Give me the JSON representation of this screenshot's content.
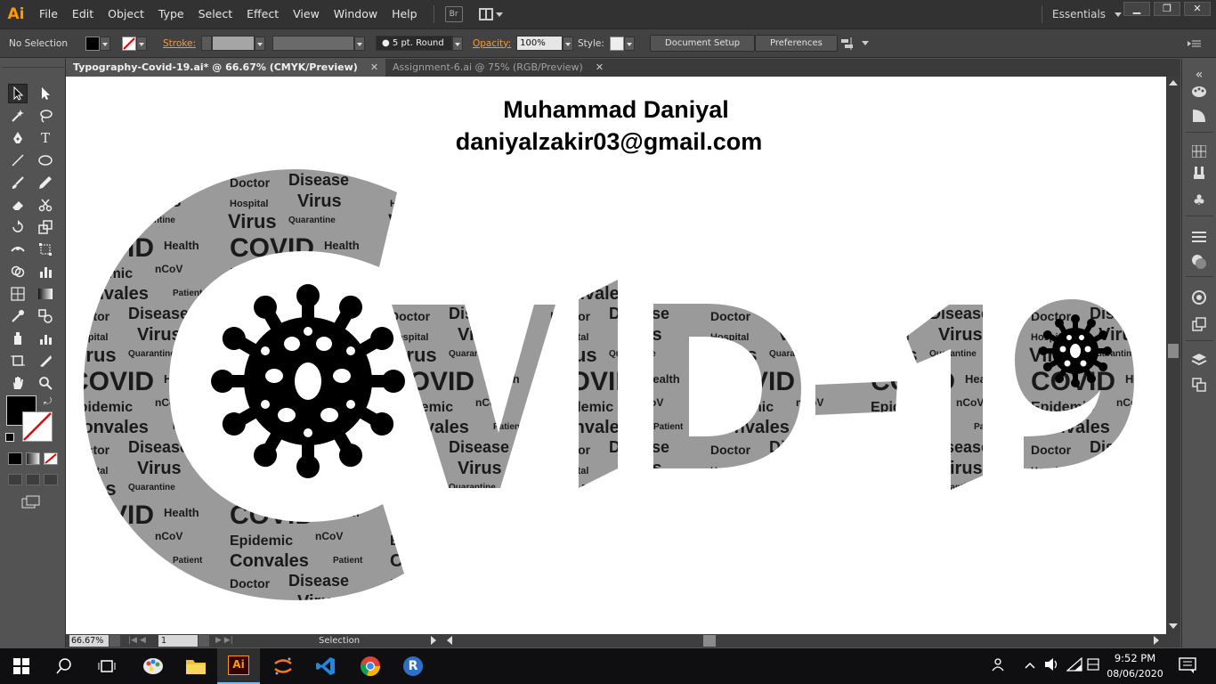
{
  "app": {
    "logo": "Ai",
    "menu": [
      "File",
      "Edit",
      "Object",
      "Type",
      "Select",
      "Effect",
      "View",
      "Window",
      "Help"
    ],
    "bridge_label": "Br",
    "workspace": "Essentials",
    "window_buttons": [
      "▁",
      "❐",
      "✕"
    ]
  },
  "control_bar": {
    "selection_label": "No Selection",
    "stroke_label": "Stroke:",
    "brush_label": "5 pt. Round",
    "opacity_label": "Opacity:",
    "opacity_value": "100%",
    "style_label": "Style:",
    "document_setup": "Document Setup",
    "preferences": "Preferences"
  },
  "tabs": [
    {
      "label": "Typography-Covid-19.ai* @ 66.67% (CMYK/Preview)",
      "close": "✕"
    },
    {
      "label": "Assignment-6.ai @ 75% (RGB/Preview)",
      "close": "✕"
    }
  ],
  "artboard": {
    "author": "Muhammad Daniyal",
    "email": "daniyalzakir03@gmail.com",
    "artwork_text": "CVID-19",
    "word_cloud": [
      "Virus",
      "COVID-19",
      "Epidemic",
      "Health",
      "Quarantine",
      "nCoV",
      "Doctor",
      "Disease",
      "Convalescence",
      "Patient",
      "Hospital"
    ]
  },
  "status_bar": {
    "zoom": "66.67%",
    "page": "1",
    "tool": "Selection"
  },
  "taskbar": {
    "time": "9:52 PM",
    "date": "08/06/2020"
  },
  "colors": {
    "accent": "#ff9a00",
    "letter_fill": "#9a9a9a",
    "virus_fill": "#000000"
  }
}
